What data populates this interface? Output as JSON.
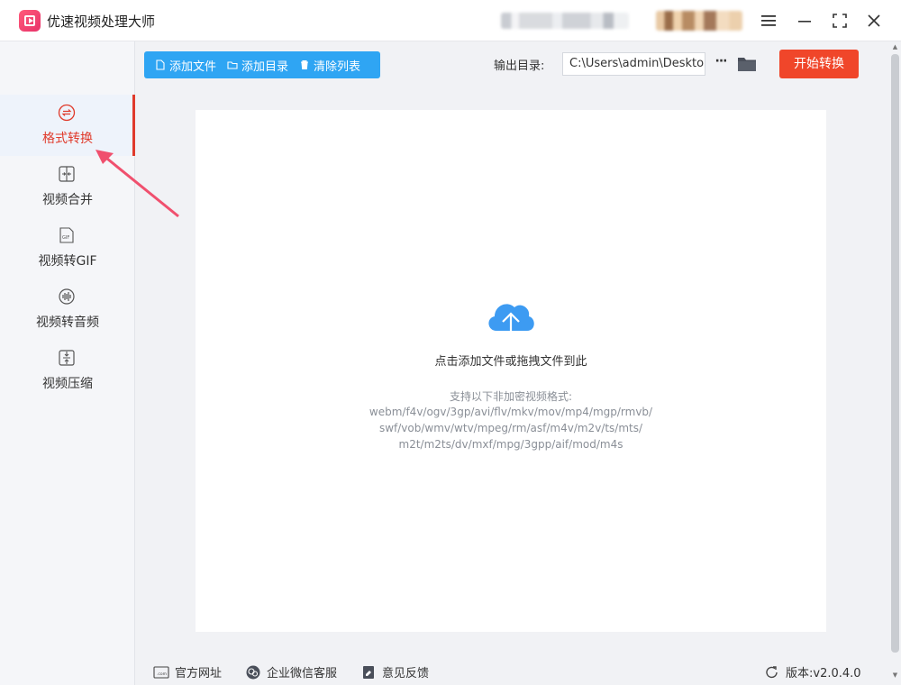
{
  "app": {
    "title": "优速视频处理大师"
  },
  "window": {
    "menu_icon": "hamburger-icon",
    "minimize_icon": "minimize-icon",
    "maximize_icon": "maximize-icon",
    "close_icon": "close-icon"
  },
  "sidebar": {
    "items": [
      {
        "label": "格式转换",
        "icon": "convert-icon",
        "active": true
      },
      {
        "label": "视频合并",
        "icon": "merge-icon",
        "active": false
      },
      {
        "label": "视频转GIF",
        "icon": "gif-icon",
        "active": false
      },
      {
        "label": "视频转音频",
        "icon": "audio-icon",
        "active": false
      },
      {
        "label": "视频压缩",
        "icon": "compress-icon",
        "active": false
      }
    ]
  },
  "toolbar": {
    "add_file": "添加文件",
    "add_folder": "添加目录",
    "clear_list": "清除列表",
    "output_label": "输出目录:",
    "output_path": "C:\\Users\\admin\\Desktop",
    "more_label": "···",
    "start_label": "开始转换"
  },
  "dropzone": {
    "title": "点击添加文件或拖拽文件到此",
    "formats_head": "支持以下非加密视频格式:",
    "formats_lines": [
      "webm/f4v/ogv/3gp/avi/flv/mkv/mov/mp4/mgp/rmvb/",
      "swf/vob/wmv/wtv/mpeg/rm/asf/m4v/m2v/ts/mts/",
      "m2t/m2ts/dv/mxf/mpg/3gpp/aif/mod/m4s"
    ]
  },
  "footer": {
    "website": "官方网址",
    "wechat": "企业微信客服",
    "feedback": "意见反馈",
    "version": "版本:v2.0.4.0"
  },
  "colors": {
    "accent_blue": "#2fa5f3",
    "accent_red": "#f0462a",
    "active_text": "#e03a2b",
    "cloud": "#3d9bf2"
  }
}
